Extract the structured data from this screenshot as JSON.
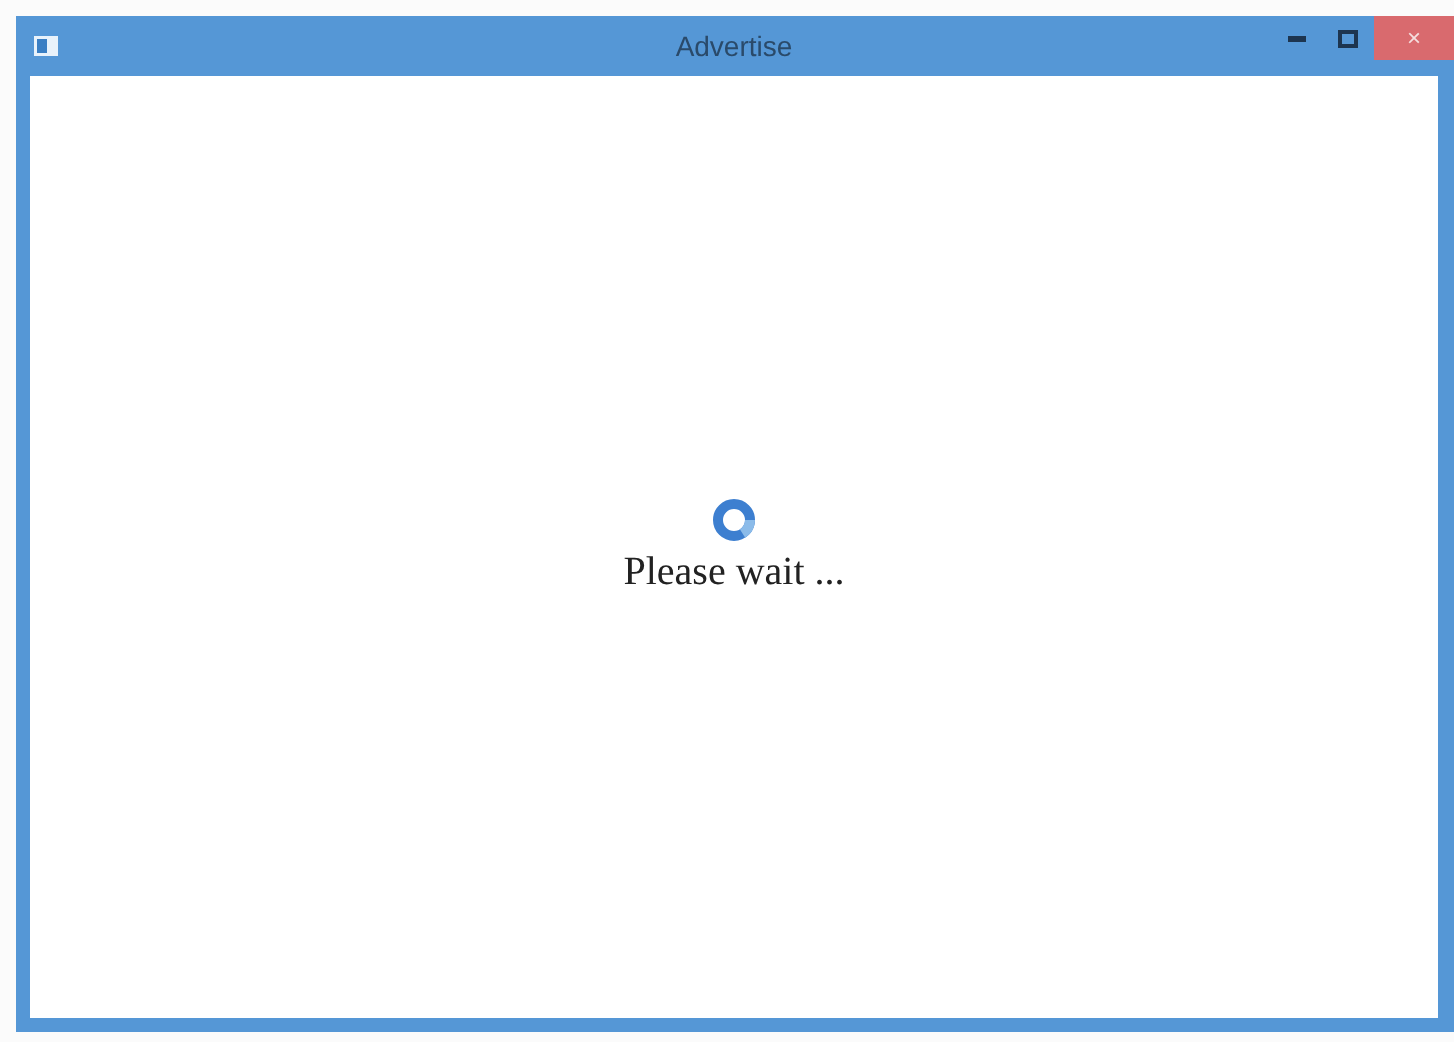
{
  "window": {
    "title": "Advertise",
    "close": "×"
  },
  "content": {
    "message": "Please wait ..."
  }
}
